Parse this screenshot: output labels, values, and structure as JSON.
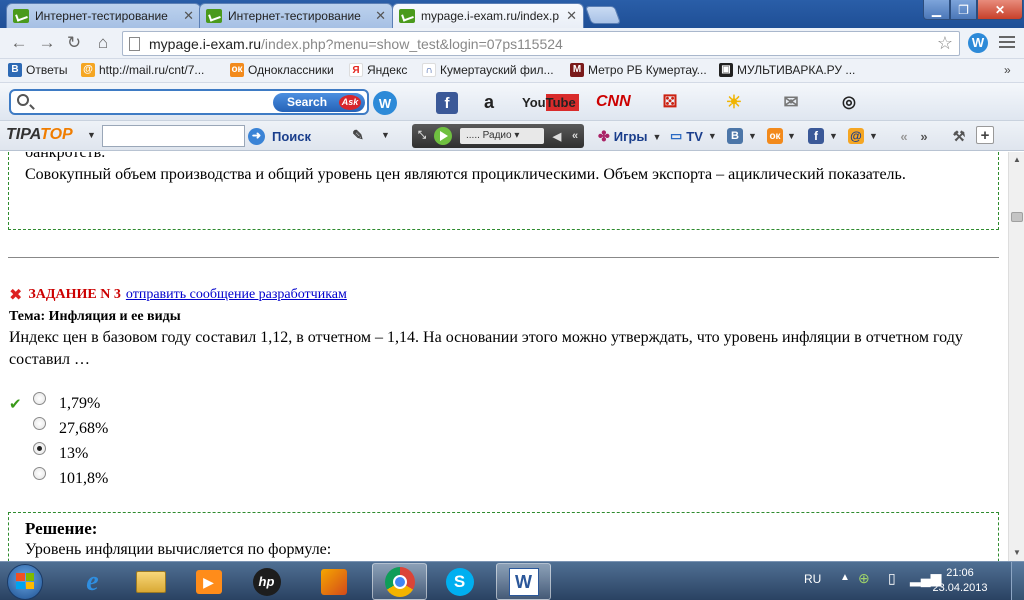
{
  "tabs": [
    {
      "title": "Интернет-тестирование"
    },
    {
      "title": "Интернет-тестирование"
    },
    {
      "title": "mypage.i-exam.ru/index.p"
    }
  ],
  "address": {
    "domain": "mypage.i-exam.ru",
    "path": "/index.php?menu=show_test&login=07ps115524"
  },
  "bookmarks": [
    {
      "label": "Ответы",
      "icon": "b-icon",
      "color": "#2d6ab5"
    },
    {
      "label": "http://mail.ru/cnt/7...",
      "icon": "at-icon",
      "color": "#f5a623"
    },
    {
      "label": "Одноклассники",
      "icon": "ok-icon",
      "color": "#f28a1c"
    },
    {
      "label": "Яндекс",
      "icon": "yandex-icon",
      "color": "#e52620"
    },
    {
      "label": "Кумертауский фил...",
      "icon": "horseshoe-icon",
      "color": "#2a4fa0"
    },
    {
      "label": "Метро РБ Кумертау...",
      "icon": "m-icon",
      "color": "#7a1a1a"
    },
    {
      "label": "МУЛЬТИВАРКА.РУ ...",
      "icon": "camera-icon",
      "color": "#222222"
    }
  ],
  "bookmarks_more": "»",
  "ask_toolbar": {
    "search_button": "Search",
    "ask_logo": "Ask",
    "youtube": "YouTube",
    "cnn": "CNN"
  },
  "tiptop_toolbar": {
    "logo_tip": "TIPA",
    "logo_top": "TOP",
    "search_label": "Поиск",
    "radio_label": "..... Радио",
    "games_label": "Игры",
    "tv_label": "TV"
  },
  "content": {
    "prev_text_line1": "банкротств.",
    "prev_text_line2": "Совокупный объем производства и общий уровень цен являются проциклическими. Объем экспорта – ациклический показатель.",
    "task_label": "ЗАДАНИЕ N 3",
    "task_link": "отправить сообщение разработчикам",
    "topic": "Тема: Инфляция и ее виды",
    "question": "Индекс цен в базовом году составил 1,12, в отчетном – 1,14. На основании этого можно утверждать, что уровень инфляции в отчетном году составил …",
    "answers": [
      {
        "text": "1,79%",
        "correct": true,
        "selected": false
      },
      {
        "text": "27,68%",
        "correct": false,
        "selected": false
      },
      {
        "text": "13%",
        "correct": false,
        "selected": true
      },
      {
        "text": "101,8%",
        "correct": false,
        "selected": false
      }
    ],
    "solution_title": "Решение:",
    "solution_text": "Уровень инфляции вычисляется по формуле:"
  },
  "taskbar": {
    "lang": "RU",
    "time": "21:06",
    "date": "23.04.2013"
  }
}
